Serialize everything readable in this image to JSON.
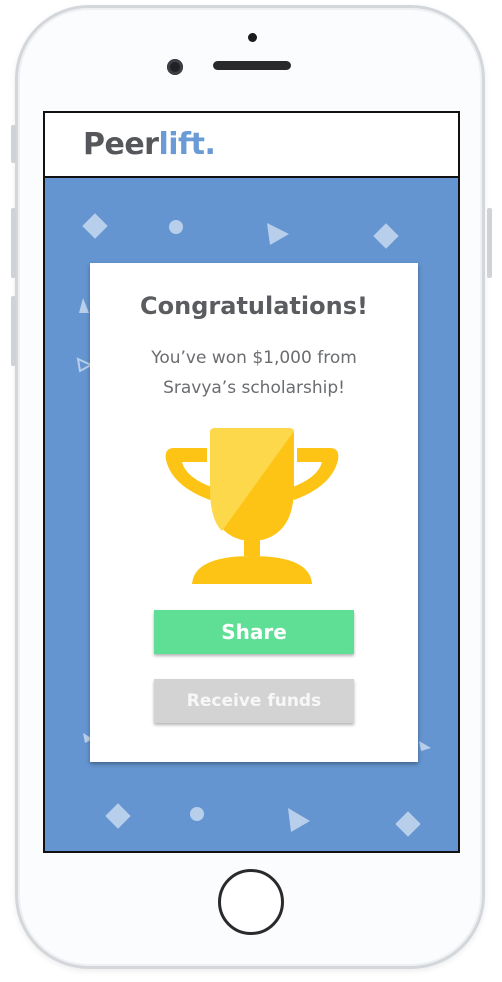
{
  "app": {
    "logo_part1": "Peer",
    "logo_part2": "lift."
  },
  "dialog": {
    "title": "Congratulations!",
    "message_line1": "You’ve won $1,000 from",
    "message_line2": "Sravya’s scholarship!",
    "trophy_icon": "trophy-icon",
    "share_label": "Share",
    "receive_label": "Receive funds"
  },
  "colors": {
    "background": "#6495d0",
    "logo_dark": "#55575b",
    "logo_accent": "#6a9bd6",
    "share_button": "#5fde96",
    "receive_button": "#d3d3d3",
    "trophy": "#fdc415"
  }
}
